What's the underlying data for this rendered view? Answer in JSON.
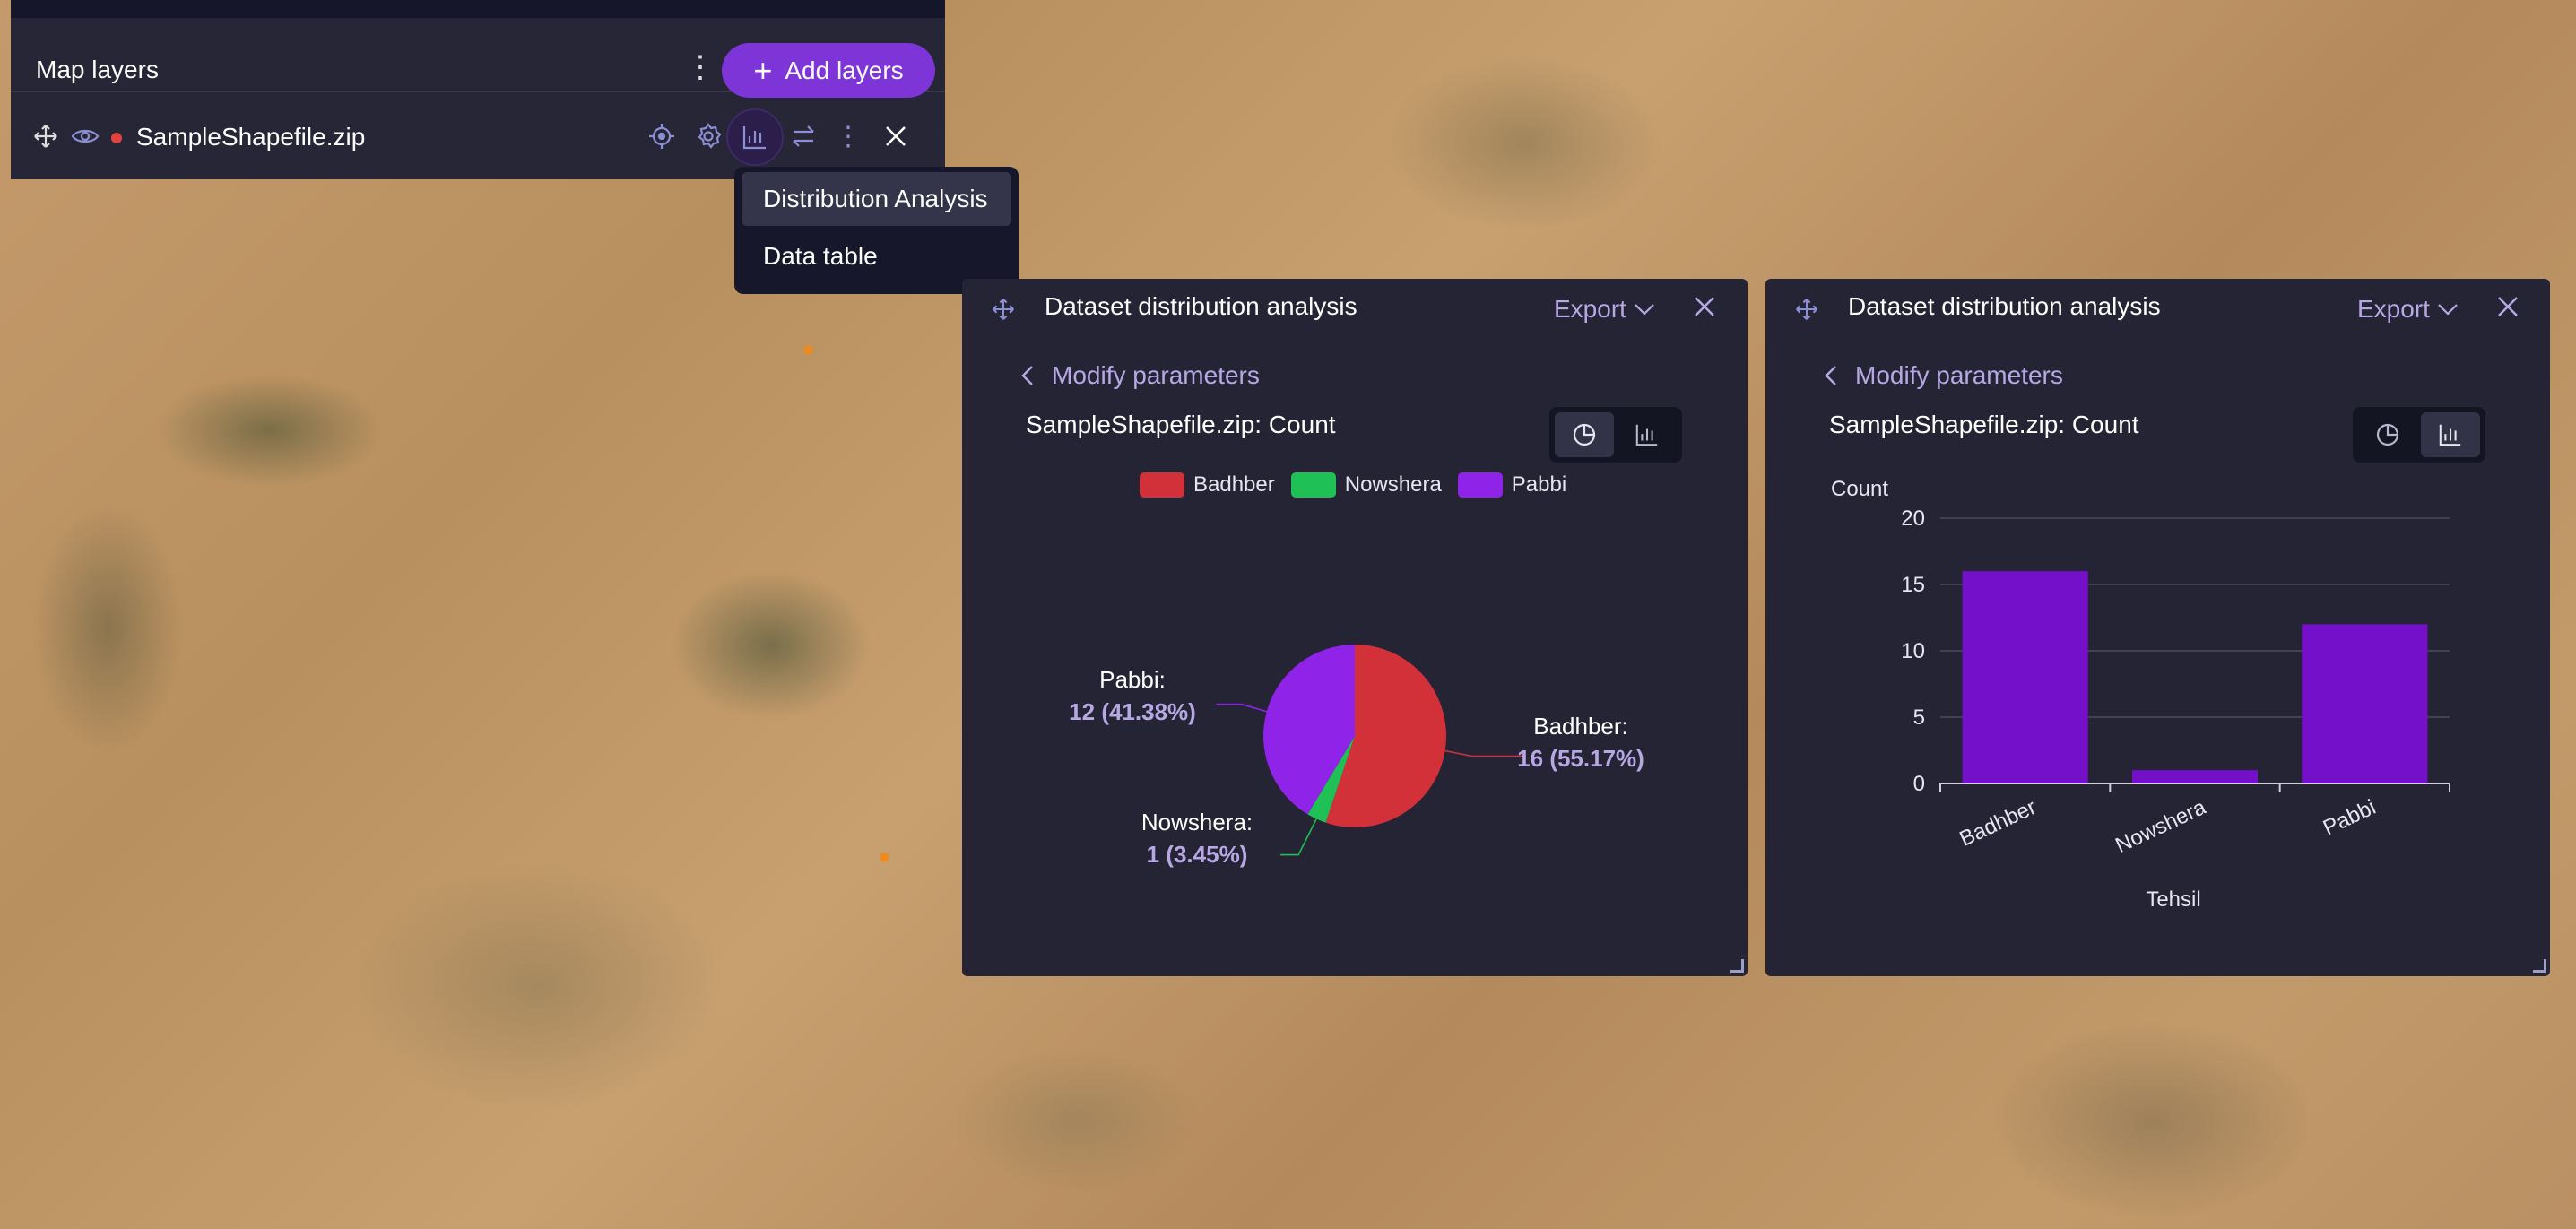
{
  "colors": {
    "accent": "#7d35d8",
    "badhber": "#d3313a",
    "nowshera": "#1fc055",
    "pabbi": "#8f23e8",
    "bar": "#7410c9"
  },
  "layers_panel": {
    "title": "Map layers",
    "add_button": "Add layers",
    "layer": {
      "name": "SampleShapefile.zip"
    }
  },
  "menu": {
    "items": [
      {
        "label": "Distribution Analysis",
        "active": true
      },
      {
        "label": "Data table",
        "active": false
      }
    ]
  },
  "panel1": {
    "title": "Dataset distribution analysis",
    "export": "Export",
    "back": "Modify parameters",
    "chart_title": "SampleShapefile.zip: Count"
  },
  "panel2": {
    "title": "Dataset distribution analysis",
    "export": "Export",
    "back": "Modify parameters",
    "chart_title": "SampleShapefile.zip: Count"
  },
  "chart_data": [
    {
      "type": "pie",
      "title": "SampleShapefile.zip: Count",
      "legend": [
        "Badhber",
        "Nowshera",
        "Pabbi"
      ],
      "legend_position": "top",
      "categories": [
        "Badhber",
        "Nowshera",
        "Pabbi"
      ],
      "values": [
        16,
        1,
        12
      ],
      "labels": [
        {
          "name": "Badhber:",
          "value": "16 (55.17%)"
        },
        {
          "name": "Nowshera:",
          "value": "1 (3.45%)"
        },
        {
          "name": "Pabbi:",
          "value": "12 (41.38%)"
        }
      ]
    },
    {
      "type": "bar",
      "title": "SampleShapefile.zip: Count",
      "categories": [
        "Badhber",
        "Nowshera",
        "Pabbi"
      ],
      "values": [
        16,
        1,
        12
      ],
      "xlabel": "Tehsil",
      "ylabel": "Count",
      "ylim": [
        0,
        20
      ],
      "yticks": [
        "0",
        "5",
        "10",
        "15",
        "20"
      ],
      "grid": true
    }
  ]
}
